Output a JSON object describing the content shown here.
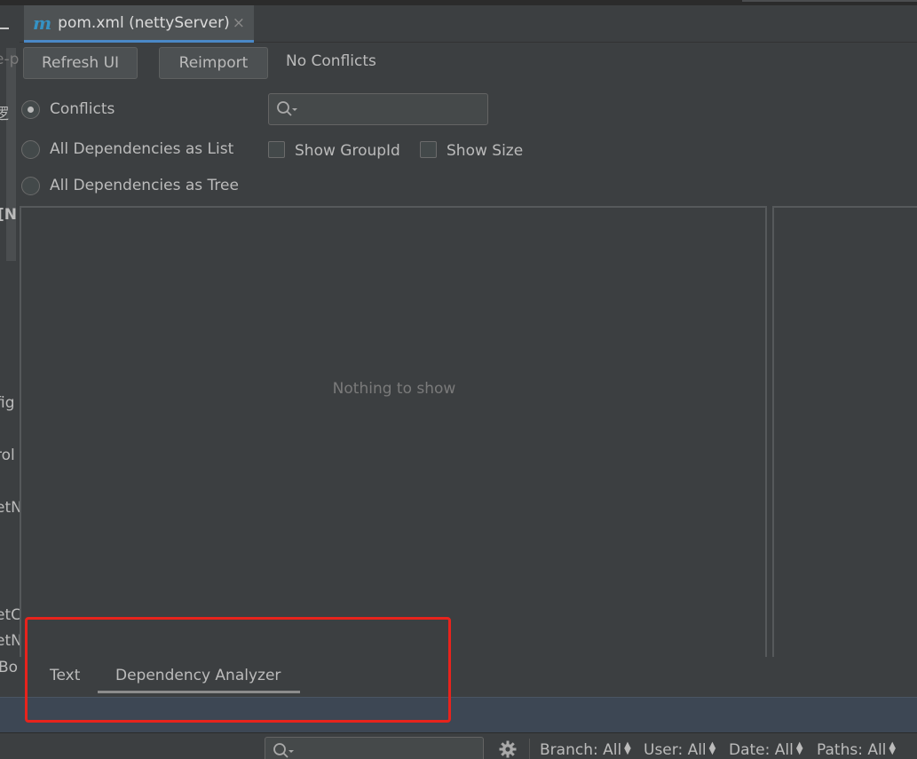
{
  "editor": {
    "tab_label": "pom.xml (nettyServer)",
    "tab_icon": "m",
    "close_glyph": "×"
  },
  "toolbar": {
    "refresh_label": "Refresh UI",
    "reimport_label": "Reimport",
    "status": "No Conflicts"
  },
  "view_modes": [
    {
      "label": "Conflicts",
      "selected": true
    },
    {
      "label": "All Dependencies as List",
      "selected": false
    },
    {
      "label": "All Dependencies as Tree",
      "selected": false
    }
  ],
  "options": {
    "show_groupid_label": "Show GroupId",
    "show_size_label": "Show Size"
  },
  "panel": {
    "empty_text": "Nothing to show"
  },
  "bottom_tabs": [
    {
      "label": "Text",
      "active": false
    },
    {
      "label": "Dependency Analyzer",
      "active": true
    }
  ],
  "gutter": {
    "fragments": [
      "e-p",
      "逻",
      "[N",
      "fig",
      "rol",
      "etN",
      "etC",
      "etN",
      "Bo"
    ]
  },
  "vcs": {
    "branch": "Branch: All",
    "user": "User: All",
    "date": "Date: All",
    "paths": "Paths: All"
  },
  "colors": {
    "background": "#3c3f41",
    "accent": "#4a88c7",
    "highlight": "#e8231c",
    "tool_strip": "#3d4754"
  }
}
